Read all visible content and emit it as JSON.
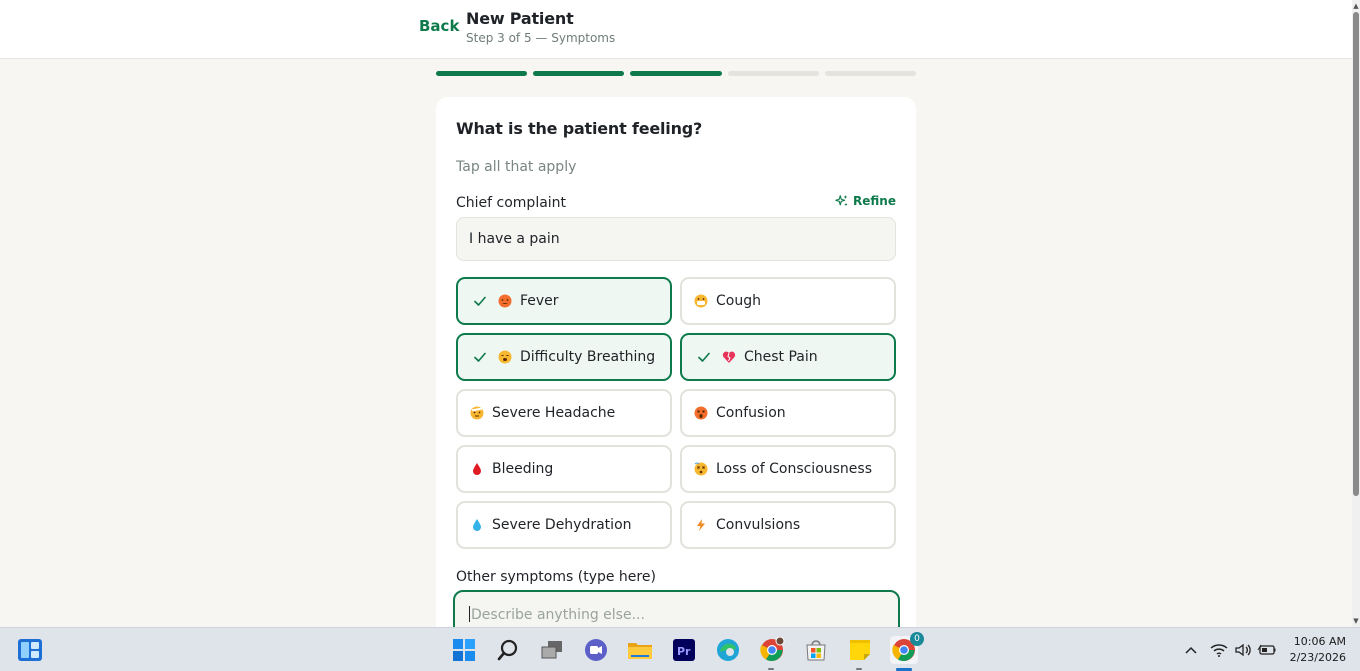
{
  "header": {
    "back_label": "Back",
    "title": "New Patient",
    "step": "Step 3 of 5 — Symptoms"
  },
  "progress": {
    "total_steps": 5,
    "completed_steps": 3
  },
  "card": {
    "question": "What is the patient feeling?",
    "subtitle": "Tap all that apply",
    "chief_complaint": {
      "label": "Chief complaint",
      "refine_label": "Refine",
      "value": "I have a pain"
    },
    "symptoms": [
      {
        "label": "Fever",
        "icon": "hot-face-icon",
        "selected": true
      },
      {
        "label": "Cough",
        "icon": "mask-face-icon",
        "selected": false
      },
      {
        "label": "Difficulty Breathing",
        "icon": "exhaling-face-icon",
        "selected": true
      },
      {
        "label": "Chest Pain",
        "icon": "broken-heart-icon",
        "selected": true
      },
      {
        "label": "Severe Headache",
        "icon": "bandage-face-icon",
        "selected": false
      },
      {
        "label": "Confusion",
        "icon": "astonished-face-icon",
        "selected": false
      },
      {
        "label": "Bleeding",
        "icon": "blood-drop-icon",
        "selected": false
      },
      {
        "label": "Loss of Consciousness",
        "icon": "dizzy-face-icon",
        "selected": false
      },
      {
        "label": "Severe Dehydration",
        "icon": "water-drop-icon",
        "selected": false
      },
      {
        "label": "Convulsions",
        "icon": "lightning-icon",
        "selected": false
      }
    ],
    "other": {
      "label": "Other symptoms (type here)",
      "placeholder": "Describe anything else..."
    }
  },
  "taskbar": {
    "apps": [
      "widgets-icon",
      "start-icon",
      "search-icon",
      "task-view-icon",
      "teams-chat-icon",
      "file-explorer-icon",
      "premiere-pro-icon",
      "edge-icon",
      "chrome-icon",
      "store-icon",
      "sticky-notes-icon",
      "chrome-active-icon"
    ],
    "chrome_badge": "0",
    "time": "10:06 AM",
    "date": "2/23/2026"
  },
  "colors": {
    "accent": "#0e7a4b",
    "selected_bg": "#eef7f2",
    "page_bg": "#f7f6f2"
  }
}
